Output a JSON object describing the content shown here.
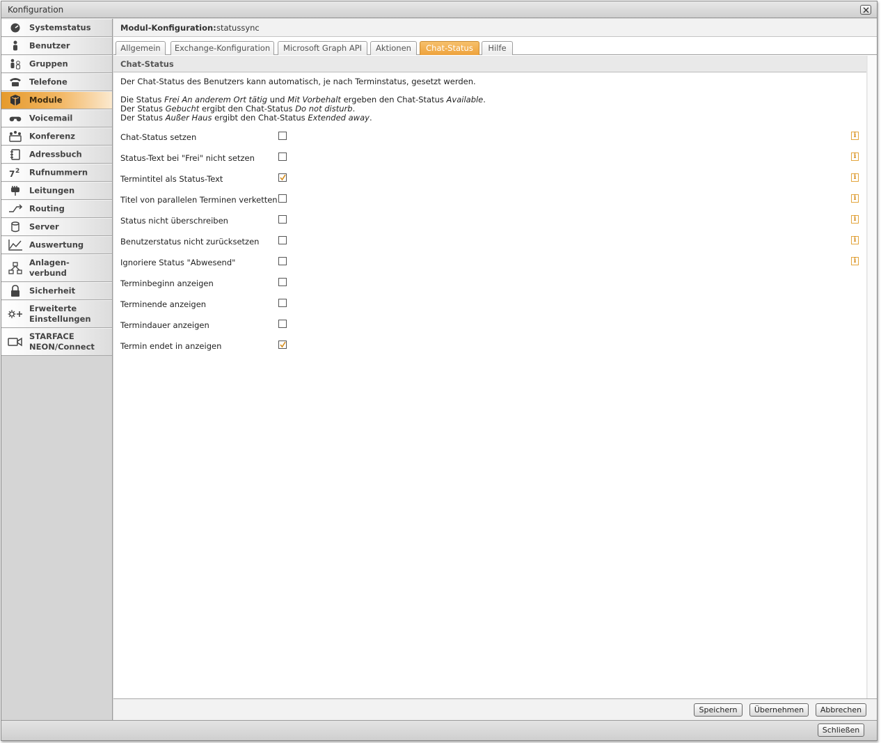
{
  "window": {
    "title": "Konfiguration",
    "close_icon": "close-icon"
  },
  "sidebar": {
    "items": [
      {
        "label": "Systemstatus",
        "icon": "gauge-icon"
      },
      {
        "label": "Benutzer",
        "icon": "user-icon"
      },
      {
        "label": "Gruppen",
        "icon": "group-icon"
      },
      {
        "label": "Telefone",
        "icon": "phone-icon"
      },
      {
        "label": "Module",
        "icon": "module-box-icon",
        "active": true
      },
      {
        "label": "Voicemail",
        "icon": "voicemail-icon"
      },
      {
        "label": "Konferenz",
        "icon": "conference-icon"
      },
      {
        "label": "Adressbuch",
        "icon": "addressbook-icon"
      },
      {
        "label": "Rufnummern",
        "icon": "numbers-icon"
      },
      {
        "label": "Leitungen",
        "icon": "plug-icon"
      },
      {
        "label": "Routing",
        "icon": "routing-icon"
      },
      {
        "label": "Server",
        "icon": "server-icon"
      },
      {
        "label": "Auswertung",
        "icon": "chart-icon"
      },
      {
        "label": "Anlagen-\nverbund",
        "icon": "network-icon"
      },
      {
        "label": "Sicherheit",
        "icon": "lock-icon"
      },
      {
        "label": "Erweiterte\nEinstellungen",
        "icon": "advanced-settings-icon"
      },
      {
        "label": "STARFACE\nNEON/Connect",
        "icon": "camera-icon"
      }
    ]
  },
  "module_header": {
    "label": "Modul-Konfiguration:",
    "value": "statussync"
  },
  "tabs": [
    {
      "label": "Allgemein"
    },
    {
      "label": "Exchange-Konfiguration"
    },
    {
      "label": "Microsoft Graph API"
    },
    {
      "label": "Aktionen"
    },
    {
      "label": "Chat-Status",
      "active": true
    },
    {
      "label": "Hilfe"
    }
  ],
  "section": {
    "title": "Chat-Status",
    "intro": "Der Chat-Status des Benutzers kann automatisch, je nach Terminstatus, gesetzt werden.",
    "line1": {
      "a": "Die Status ",
      "b": "Frei An anderem Ort tätig",
      "c": " und ",
      "d": "Mit Vorbehalt",
      "e": " ergeben den Chat-Status ",
      "f": "Available",
      "g": "."
    },
    "line2": {
      "a": "Der Status ",
      "b": "Gebucht",
      "c": " ergibt den Chat-Status ",
      "d": "Do not disturb",
      "e": "."
    },
    "line3": {
      "a": "Der Status ",
      "b": "Außer Haus",
      "c": " ergibt den Chat-Status ",
      "d": "Extended away",
      "e": "."
    }
  },
  "options": [
    {
      "label": "Chat-Status setzen",
      "checked": false,
      "info": true
    },
    {
      "label": "Status-Text bei \"Frei\" nicht setzen",
      "checked": false,
      "info": true
    },
    {
      "label": "Termintitel als Status-Text",
      "checked": true,
      "info": true
    },
    {
      "label": "Titel von parallelen Terminen verketten",
      "checked": false,
      "info": true
    },
    {
      "label": "Status nicht überschreiben",
      "checked": false,
      "info": true
    },
    {
      "label": "Benutzerstatus nicht zurücksetzen",
      "checked": false,
      "info": true
    },
    {
      "label": "Ignoriere Status \"Abwesend\"",
      "checked": false,
      "info": true
    },
    {
      "label": "Terminbeginn anzeigen",
      "checked": false,
      "info": false
    },
    {
      "label": "Terminende anzeigen",
      "checked": false,
      "info": false
    },
    {
      "label": "Termindauer anzeigen",
      "checked": false,
      "info": false
    },
    {
      "label": "Termin endet in anzeigen",
      "checked": true,
      "info": false
    }
  ],
  "info_icon_glyph": "i",
  "footer": {
    "save": "Speichern",
    "apply": "Übernehmen",
    "cancel": "Abbrechen"
  },
  "bottom": {
    "close": "Schließen"
  },
  "colors": {
    "accent": "#eea23b",
    "check": "#d68d1c"
  }
}
